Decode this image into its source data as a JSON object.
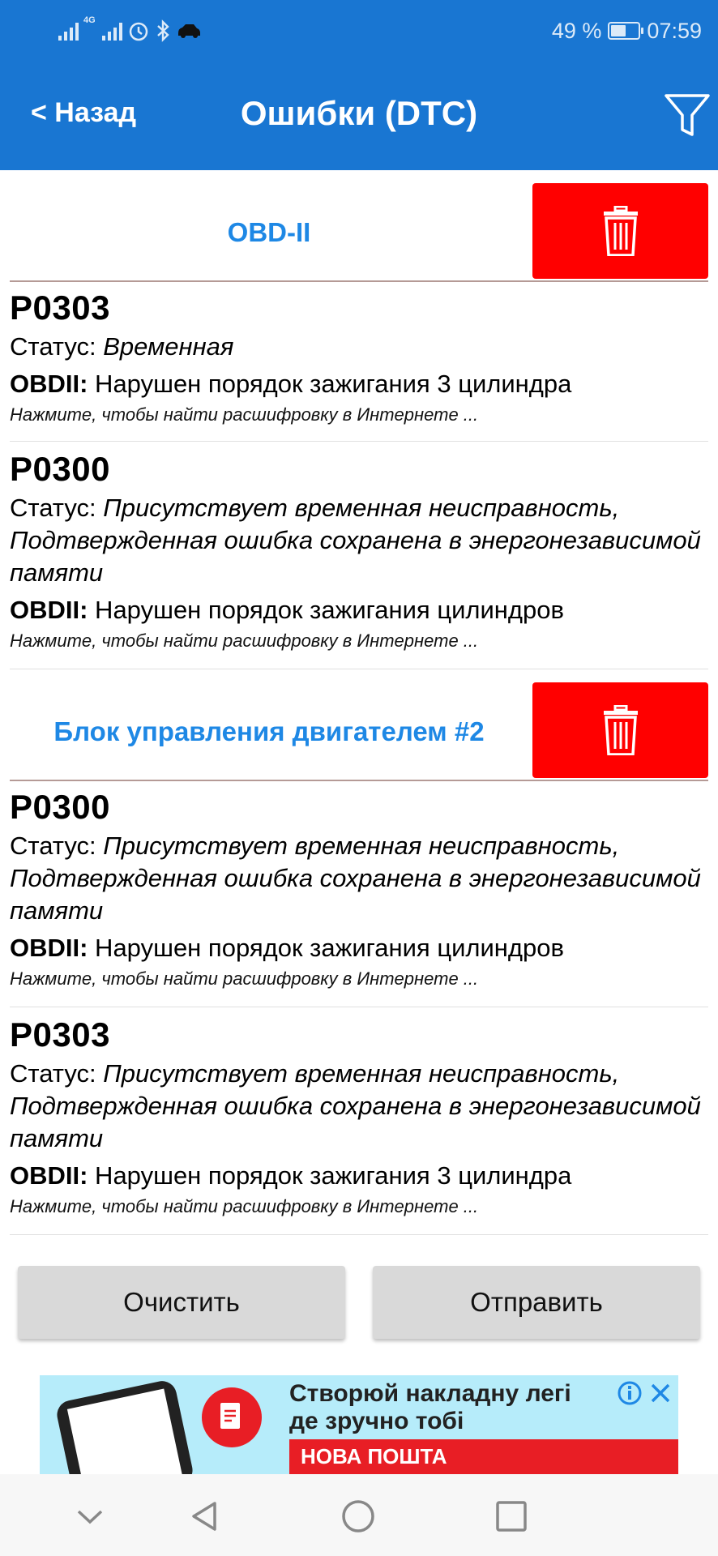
{
  "status_bar": {
    "network_tag": "4G",
    "battery_percent_text": "49 %",
    "battery_level": 0.49,
    "time": "07:59"
  },
  "app_bar": {
    "back_label": "< Назад",
    "title": "Ошибки (DTC)",
    "filter_icon": "filter-icon"
  },
  "groups": [
    {
      "title": "OBD-II",
      "items": [
        {
          "code": "P0303",
          "status_label": "Статус: ",
          "status_value": "Временная",
          "desc_prefix": "OBDII:",
          "desc": " Нарушен порядок зажигания 3 цилиндра",
          "hint": "Нажмите, чтобы найти расшифровку в Интернете ..."
        },
        {
          "code": "P0300",
          "status_label": "Статус: ",
          "status_value": "Присутствует временная неисправность, Подтвержденная ошибка сохранена в энергонезависимой памяти",
          "desc_prefix": "OBDII:",
          "desc": " Нарушен порядок зажигания цилиндров",
          "hint": "Нажмите, чтобы найти расшифровку в Интернете ..."
        }
      ]
    },
    {
      "title": "Блок управления двигателем #2",
      "items": [
        {
          "code": "P0300",
          "status_label": "Статус: ",
          "status_value": "Присутствует временная неисправность, Подтвержденная ошибка сохранена в энергонезависимой памяти",
          "desc_prefix": "OBDII:",
          "desc": " Нарушен порядок зажигания цилиндров",
          "hint": "Нажмите, чтобы найти расшифровку в Интернете ..."
        },
        {
          "code": "P0303",
          "status_label": "Статус: ",
          "status_value": "Присутствует временная неисправность, Подтвержденная ошибка сохранена в энергонезависимой памяти",
          "desc_prefix": "OBDII:",
          "desc": " Нарушен порядок зажигания 3 цилиндра",
          "hint": "Нажмите, чтобы найти расшифровку в Интернете ..."
        }
      ]
    }
  ],
  "actions": {
    "clear_label": "Очистить",
    "send_label": "Отправить"
  },
  "ad": {
    "headline_line1": "Створюй накладну легі",
    "headline_line2": "де зручно тобі",
    "brand": "НОВА ПОШТА"
  },
  "colors": {
    "primary": "#1976d2",
    "group_title": "#1e88e5",
    "delete_button": "#ff0000",
    "action_button": "#d9d9d9",
    "ad_background": "#b6ecfa",
    "ad_brand": "#e81e25"
  }
}
